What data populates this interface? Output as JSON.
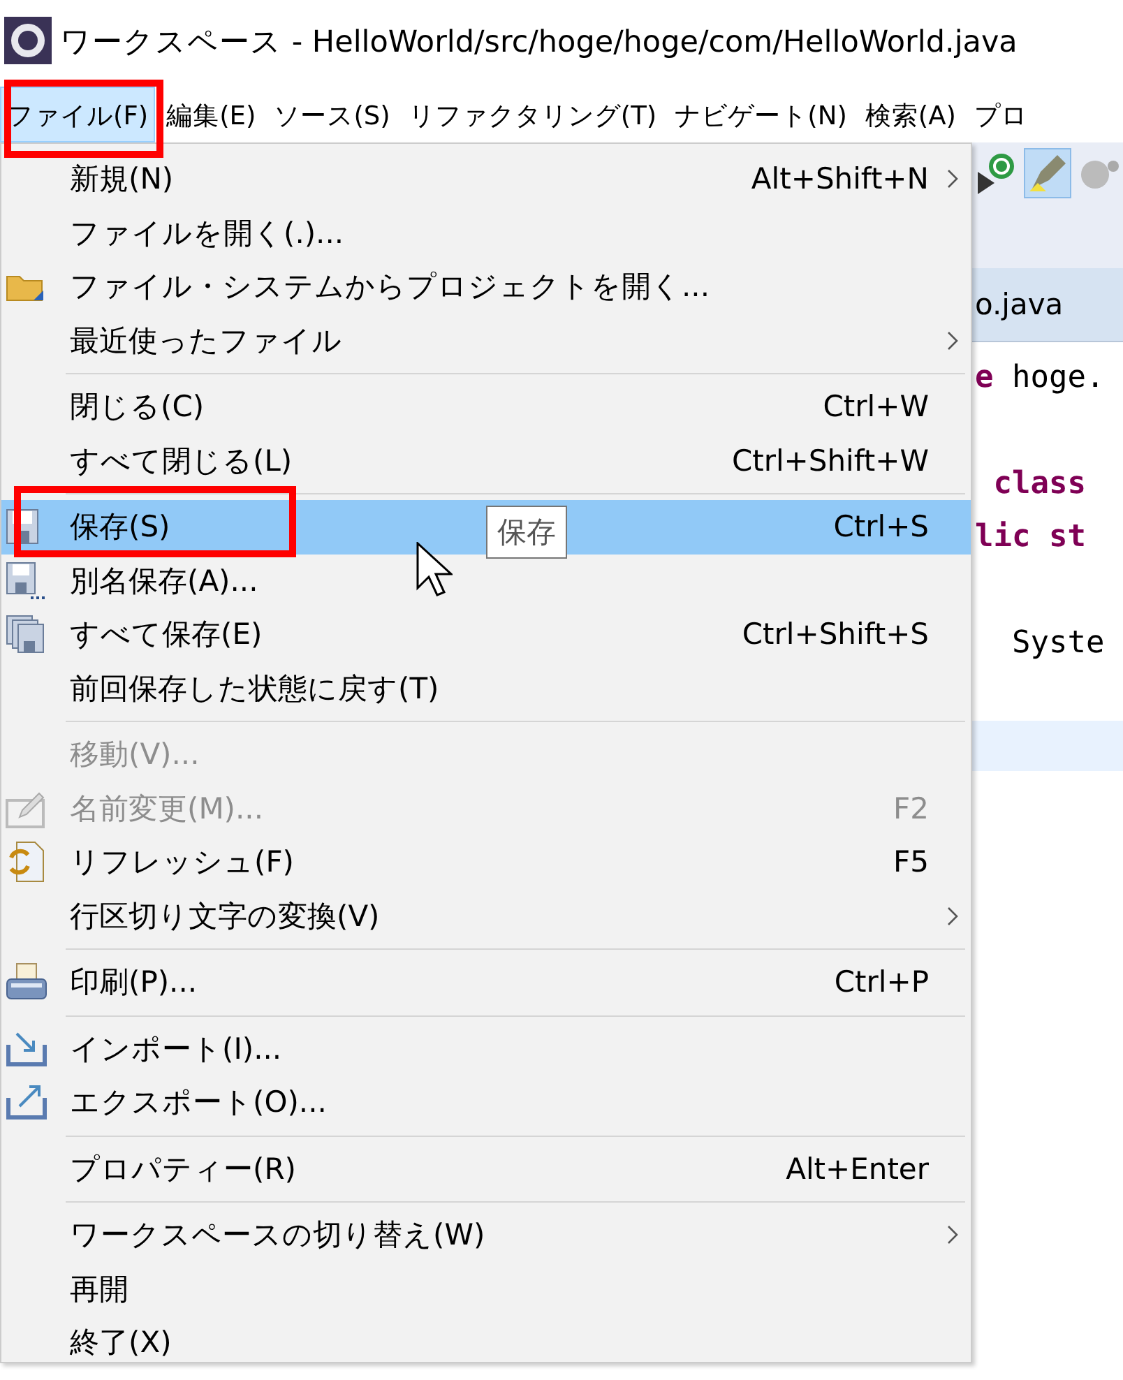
{
  "window": {
    "title": "ワークスペース - HelloWorld/src/hoge/hoge/com/HelloWorld.java"
  },
  "menubar": [
    {
      "label": "ファイル(F)",
      "selected": true
    },
    {
      "label": "編集(E)",
      "selected": false
    },
    {
      "label": "ソース(S)",
      "selected": false
    },
    {
      "label": "リファクタリング(T)",
      "selected": false
    },
    {
      "label": "ナビゲート(N)",
      "selected": false
    },
    {
      "label": "検索(A)",
      "selected": false
    },
    {
      "label": "プロ",
      "selected": false
    }
  ],
  "menu": {
    "items": [
      {
        "kind": "item",
        "label": "新規(N)",
        "shortcut": "Alt+Shift+N",
        "submenu": true,
        "disabled": false,
        "selected": false
      },
      {
        "kind": "item",
        "label": "ファイルを開く(.)...",
        "submenu": false,
        "disabled": false,
        "selected": false
      },
      {
        "kind": "item",
        "label": "ファイル・システムからプロジェクトを開く...",
        "submenu": false,
        "disabled": false,
        "selected": false
      },
      {
        "kind": "item",
        "label": "最近使ったファイル",
        "submenu": true,
        "disabled": false,
        "selected": false
      },
      {
        "kind": "separator"
      },
      {
        "kind": "item",
        "label": "閉じる(C)",
        "shortcut": "Ctrl+W",
        "submenu": false,
        "disabled": false,
        "selected": false
      },
      {
        "kind": "item",
        "label": "すべて閉じる(L)",
        "shortcut": "Ctrl+Shift+W",
        "submenu": false,
        "disabled": false,
        "selected": false
      },
      {
        "kind": "separator"
      },
      {
        "kind": "item",
        "label": "保存(S)",
        "shortcut": "Ctrl+S",
        "submenu": false,
        "disabled": false,
        "selected": true
      },
      {
        "kind": "item",
        "label": "別名保存(A)...",
        "submenu": false,
        "disabled": false,
        "selected": false
      },
      {
        "kind": "item",
        "label": "すべて保存(E)",
        "shortcut": "Ctrl+Shift+S",
        "submenu": false,
        "disabled": false,
        "selected": false
      },
      {
        "kind": "item",
        "label": "前回保存した状態に戻す(T)",
        "submenu": false,
        "disabled": false,
        "selected": false
      },
      {
        "kind": "separator"
      },
      {
        "kind": "item",
        "label": "移動(V)...",
        "submenu": false,
        "disabled": true,
        "selected": false
      },
      {
        "kind": "item",
        "label": "名前変更(M)...",
        "shortcut": "F2",
        "submenu": false,
        "disabled": true,
        "selected": false
      },
      {
        "kind": "item",
        "label": "リフレッシュ(F)",
        "shortcut": "F5",
        "submenu": false,
        "disabled": false,
        "selected": false
      },
      {
        "kind": "item",
        "label": "行区切り文字の変換(V)",
        "submenu": true,
        "disabled": false,
        "selected": false
      },
      {
        "kind": "separator"
      },
      {
        "kind": "item",
        "label": "印刷(P)...",
        "shortcut": "Ctrl+P",
        "submenu": false,
        "disabled": false,
        "selected": false
      },
      {
        "kind": "separator"
      },
      {
        "kind": "item",
        "label": "インポート(I)...",
        "submenu": false,
        "disabled": false,
        "selected": false
      },
      {
        "kind": "item",
        "label": "エクスポート(O)...",
        "submenu": false,
        "disabled": false,
        "selected": false
      },
      {
        "kind": "separator"
      },
      {
        "kind": "item",
        "label": "プロパティー(R)",
        "shortcut": "Alt+Enter",
        "submenu": false,
        "disabled": false,
        "selected": false
      },
      {
        "kind": "separator"
      },
      {
        "kind": "item",
        "label": "ワークスペースの切り替え(W)",
        "submenu": true,
        "disabled": false,
        "selected": false
      },
      {
        "kind": "item",
        "label": "再開",
        "submenu": false,
        "disabled": false,
        "selected": false
      },
      {
        "kind": "item",
        "label": "終了(X)",
        "submenu": false,
        "disabled": false,
        "selected": false
      }
    ]
  },
  "tooltip": {
    "text": "保存"
  },
  "editor": {
    "toolbar": [
      {
        "selected": false
      },
      {
        "selected": true
      },
      {
        "selected": false
      }
    ],
    "tab_label": "o.java",
    "code_lines": [
      {
        "segments": [
          {
            "kind": "keyword",
            "text": "e"
          },
          {
            "kind": "plain",
            "text": " hoge."
          }
        ]
      },
      {
        "segments": [
          {
            "kind": "keyword",
            "text": " class"
          }
        ]
      },
      {
        "segments": [
          {
            "kind": "keyword",
            "text": "lic st"
          }
        ]
      },
      {
        "segments": [
          {
            "kind": "plain",
            "text": "  Syste"
          }
        ]
      }
    ]
  }
}
